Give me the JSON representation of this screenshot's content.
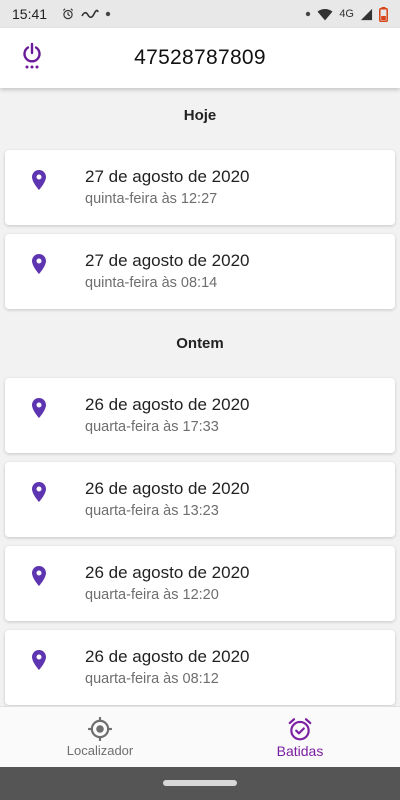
{
  "status_bar": {
    "time": "15:41",
    "network_label": "4G",
    "icons": [
      "alarm-icon",
      "app-notification-icon",
      "dot-icon",
      "wifi-icon",
      "signal-icon",
      "battery-icon"
    ]
  },
  "app_bar": {
    "title": "47528787809",
    "power_icon": "power-icon"
  },
  "sections": [
    {
      "header": "Hoje",
      "items": [
        {
          "date": "27 de agosto de 2020",
          "time": "quinta-feira às 12:27"
        },
        {
          "date": "27 de agosto de 2020",
          "time": "quinta-feira às 08:14"
        }
      ]
    },
    {
      "header": "Ontem",
      "items": [
        {
          "date": "26 de agosto de 2020",
          "time": "quarta-feira às 17:33"
        },
        {
          "date": "26 de agosto de 2020",
          "time": "quarta-feira às 13:23"
        },
        {
          "date": "26 de agosto de 2020",
          "time": "quarta-feira às 12:20"
        },
        {
          "date": "26 de agosto de 2020",
          "time": "quarta-feira às 08:12"
        }
      ]
    }
  ],
  "bottom_nav": {
    "items": [
      {
        "label": "Localizador",
        "icon": "target-icon",
        "active": false
      },
      {
        "label": "Batidas",
        "icon": "alarm-clock-icon",
        "active": true
      }
    ]
  },
  "colors": {
    "accent": "#7b1fa2",
    "pin": "#5e35b1",
    "background": "#f2f2f2"
  }
}
